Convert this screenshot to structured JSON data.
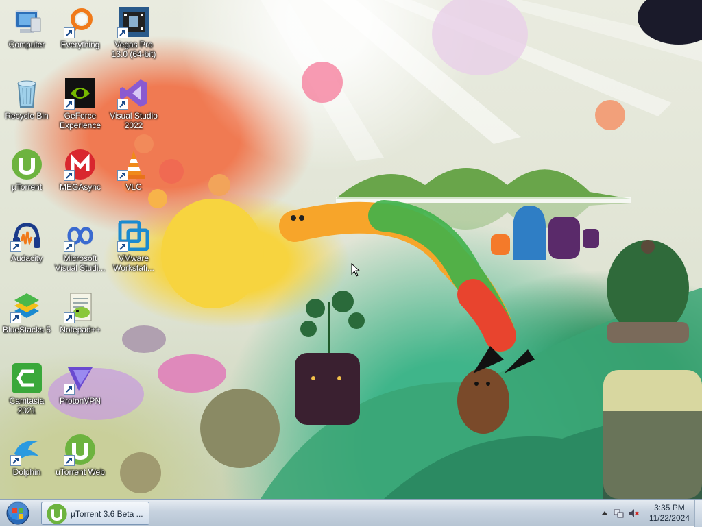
{
  "desktop_icons": [
    {
      "id": "computer",
      "label": "Computer",
      "icon": "computer-icon",
      "shortcut": false
    },
    {
      "id": "everything",
      "label": "Everything",
      "icon": "magnifier-icon",
      "shortcut": true
    },
    {
      "id": "vegas",
      "label": "Vegas Pro 13.0 (64-bit)",
      "icon": "film-icon",
      "shortcut": true
    },
    {
      "id": "recycle",
      "label": "Recycle Bin",
      "icon": "recycle-bin-icon",
      "shortcut": false
    },
    {
      "id": "geforce",
      "label": "GeForce Experience",
      "icon": "nvidia-icon",
      "shortcut": true
    },
    {
      "id": "vstudio",
      "label": "Visual Studio 2022",
      "icon": "visual-studio-icon",
      "shortcut": true
    },
    {
      "id": "utorrent",
      "label": "µTorrent",
      "icon": "utorrent-icon",
      "shortcut": false
    },
    {
      "id": "megasync",
      "label": "MEGAsync",
      "icon": "mega-icon",
      "shortcut": true
    },
    {
      "id": "vlc",
      "label": "VLC",
      "icon": "vlc-cone-icon",
      "shortcut": true
    },
    {
      "id": "audacity",
      "label": "Audacity",
      "icon": "headphones-icon",
      "shortcut": true
    },
    {
      "id": "msvs",
      "label": "Microsoft Visual Studi...",
      "icon": "infinity-icon",
      "shortcut": true
    },
    {
      "id": "vmware",
      "label": "VMware Workstati...",
      "icon": "vmware-icon",
      "shortcut": true
    },
    {
      "id": "bluestacks",
      "label": "BlueStacks 5",
      "icon": "bluestacks-icon",
      "shortcut": true
    },
    {
      "id": "notepadpp",
      "label": "Notepad++",
      "icon": "notepad-icon",
      "shortcut": true
    },
    {
      "id": "camtasia",
      "label": "Camtasia 2021",
      "icon": "camtasia-icon",
      "shortcut": false
    },
    {
      "id": "protonvpn",
      "label": "ProtonVPN",
      "icon": "triangle-icon",
      "shortcut": true
    },
    {
      "id": "dolphin",
      "label": "Dolphin",
      "icon": "dolphin-icon",
      "shortcut": true
    },
    {
      "id": "utorrentweb",
      "label": "uTorrent Web",
      "icon": "utorrent-icon",
      "shortcut": true
    }
  ],
  "taskbar": {
    "active_window": "µTorrent 3.6 Beta ...",
    "clock_time": "3:35 PM",
    "clock_date": "11/22/2024"
  },
  "colors": {
    "utorrent_green": "#6db33f",
    "taskbar_top": "#e7ecf2",
    "taskbar_bottom": "#b6c4d3"
  }
}
